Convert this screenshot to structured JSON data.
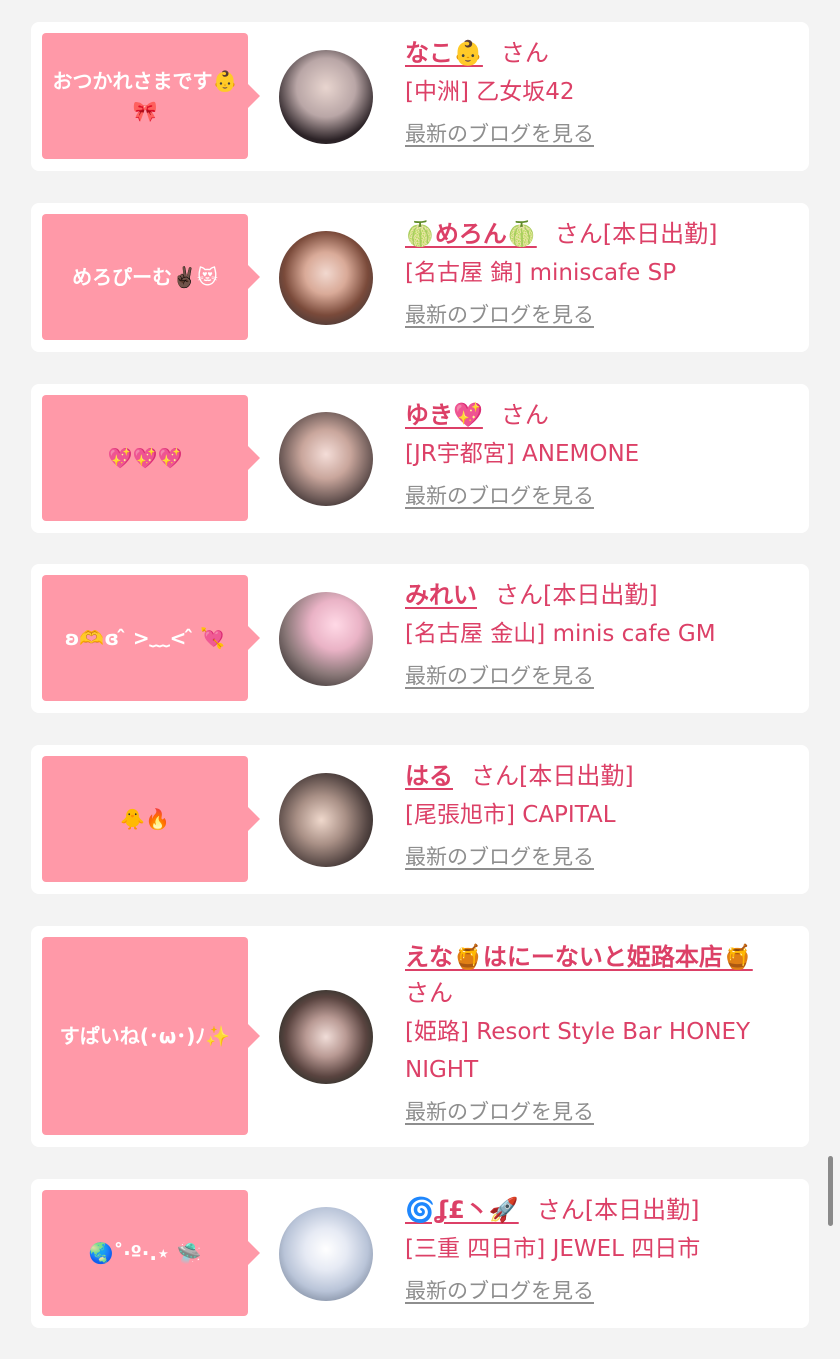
{
  "colors": {
    "accent": "#dc4067",
    "bubble": "#ff99a8",
    "muted": "#8e8e8e",
    "page_bg": "#f3f3f3"
  },
  "entries": [
    {
      "message": "おつかれさまです👶🎀",
      "name": "なこ👶",
      "suffix": "さん",
      "status": "",
      "shop": "[中洲] 乙女坂42",
      "blog_link": "最新のブログを見る",
      "avatar_icon": "girl-photo"
    },
    {
      "message": "めろぴーむ✌🏿😻",
      "name": "🍈めろん🍈",
      "suffix": "さん",
      "status": "[本日出勤]",
      "shop": "[名古屋 錦] miniscafe SP",
      "blog_link": "最新のブログを見る",
      "avatar_icon": "girl-photo"
    },
    {
      "message": "💖💖💖",
      "name": "ゆき💖",
      "suffix": "さん",
      "status": "",
      "shop": "[JR宇都宮] ANEMONE",
      "blog_link": "最新のブログを見る",
      "avatar_icon": "girl-photo"
    },
    {
      "message": "ʚ🫶ɞ ̂ >﹏< ̂ 💘",
      "name": "みれい",
      "suffix": "さん",
      "status": "[本日出勤]",
      "shop": "[名古屋 金山] minis cafe GM",
      "blog_link": "最新のブログを見る",
      "avatar_icon": "girl-photo"
    },
    {
      "message": "🐥🔥",
      "name": "はる",
      "suffix": "さん",
      "status": "[本日出勤]",
      "shop": "[尾張旭市] CAPITAL",
      "blog_link": "最新のブログを見る",
      "avatar_icon": "girl-photo"
    },
    {
      "message": "すぱいね(･ω･)ﾉ✨",
      "name": "えな🍯はにーないと姫路本店🍯",
      "suffix": "さん",
      "status": "",
      "shop": "[姫路] Resort Style Bar HONEY NIGHT",
      "blog_link": "最新のブログを見る",
      "avatar_icon": "girl-photo"
    },
    {
      "message": "🌏˚‧º·.⋆ 🛸",
      "name": "🌀ʆ£丶🚀",
      "suffix": "さん",
      "status": "[本日出勤]",
      "shop": "[三重 四日市] JEWEL 四日市",
      "blog_link": "最新のブログを見る",
      "avatar_icon": "girl-photo"
    }
  ]
}
